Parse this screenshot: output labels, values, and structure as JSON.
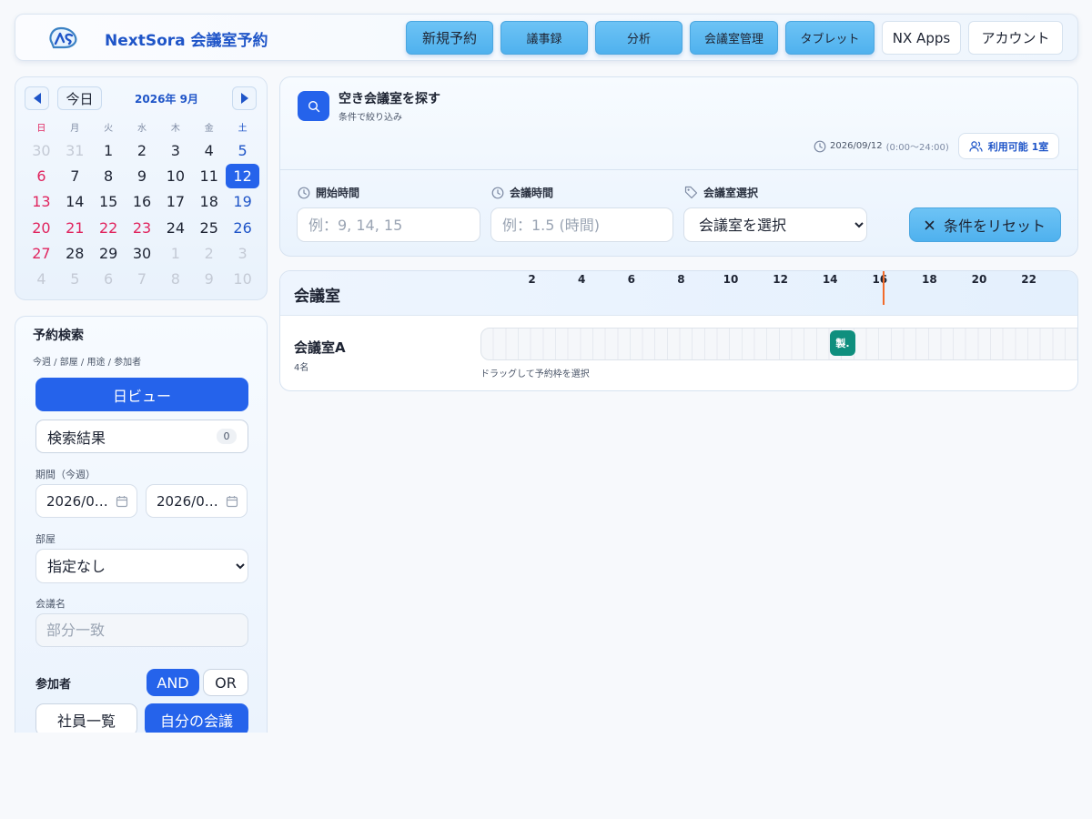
{
  "header": {
    "brand": "NextSora 会議室予約",
    "nav": [
      {
        "label": "新規予約"
      },
      {
        "label": "議事録"
      },
      {
        "label": "分析"
      },
      {
        "label": "会議室管理"
      },
      {
        "label": "タブレット"
      },
      {
        "label": "NX Apps"
      },
      {
        "label": "アカウント"
      }
    ]
  },
  "calendar": {
    "today_label": "今日",
    "month_title": "2026年 9月",
    "weekdays": [
      "日",
      "月",
      "火",
      "水",
      "木",
      "金",
      "土"
    ],
    "days": [
      {
        "d": "30",
        "t": "out"
      },
      {
        "d": "31",
        "t": "out"
      },
      {
        "d": "1",
        "t": ""
      },
      {
        "d": "2",
        "t": ""
      },
      {
        "d": "3",
        "t": ""
      },
      {
        "d": "4",
        "t": ""
      },
      {
        "d": "5",
        "t": "sat"
      },
      {
        "d": "6",
        "t": "sun"
      },
      {
        "d": "7",
        "t": ""
      },
      {
        "d": "8",
        "t": ""
      },
      {
        "d": "9",
        "t": ""
      },
      {
        "d": "10",
        "t": ""
      },
      {
        "d": "11",
        "t": ""
      },
      {
        "d": "12",
        "t": "sel"
      },
      {
        "d": "13",
        "t": "sun"
      },
      {
        "d": "14",
        "t": ""
      },
      {
        "d": "15",
        "t": ""
      },
      {
        "d": "16",
        "t": ""
      },
      {
        "d": "17",
        "t": ""
      },
      {
        "d": "18",
        "t": ""
      },
      {
        "d": "19",
        "t": "sat"
      },
      {
        "d": "20",
        "t": "sun"
      },
      {
        "d": "21",
        "t": "sun"
      },
      {
        "d": "22",
        "t": "sun"
      },
      {
        "d": "23",
        "t": "sun"
      },
      {
        "d": "24",
        "t": ""
      },
      {
        "d": "25",
        "t": ""
      },
      {
        "d": "26",
        "t": "sat"
      },
      {
        "d": "27",
        "t": "sun"
      },
      {
        "d": "28",
        "t": ""
      },
      {
        "d": "29",
        "t": ""
      },
      {
        "d": "30",
        "t": ""
      },
      {
        "d": "1",
        "t": "out"
      },
      {
        "d": "2",
        "t": "out"
      },
      {
        "d": "3",
        "t": "out"
      },
      {
        "d": "4",
        "t": "out"
      },
      {
        "d": "5",
        "t": "out"
      },
      {
        "d": "6",
        "t": "out"
      },
      {
        "d": "7",
        "t": "out"
      },
      {
        "d": "8",
        "t": "out"
      },
      {
        "d": "9",
        "t": "out"
      },
      {
        "d": "10",
        "t": "out"
      }
    ]
  },
  "search": {
    "title": "予約検索",
    "subtitle": "今週 / 部屋 / 用途 / 参加者",
    "dayview_label": "日ビュー",
    "results_label": "検索結果",
    "results_count": "0",
    "period_label": "期間（今週）",
    "date_from": "2026/0…",
    "date_to": "2026/0…",
    "room_label": "部屋",
    "room_value": "指定なし",
    "meeting_label": "会議名",
    "meeting_placeholder": "部分一致",
    "participants_label": "参加者",
    "and_label": "AND",
    "or_label": "OR",
    "employees_label": "社員一覧",
    "mine_label": "自分の会議"
  },
  "find": {
    "title": "空き会議室を探す",
    "subtitle": "条件で絞り込み",
    "date": "2026/09/12",
    "range": "(0:00〜24:00)",
    "available_label": "利用可能 1室",
    "start_label": "開始時間",
    "start_placeholder": "例：9, 14, 15",
    "duration_label": "会議時間",
    "duration_placeholder": "例：1.5 (時間)",
    "room_label": "会議室選択",
    "room_value": "会議室を選択",
    "reset_label": "条件をリセット"
  },
  "timeline": {
    "title": "会議室",
    "hours": [
      {
        "label": "2",
        "h": 2
      },
      {
        "label": "4",
        "h": 4
      },
      {
        "label": "6",
        "h": 6
      },
      {
        "label": "8",
        "h": 8
      },
      {
        "label": "10",
        "h": 10
      },
      {
        "label": "12",
        "h": 12
      },
      {
        "label": "14",
        "h": 14
      },
      {
        "label": "16",
        "h": 16
      },
      {
        "label": "18",
        "h": 18
      },
      {
        "label": "20",
        "h": 20
      },
      {
        "label": "22",
        "h": 22
      }
    ],
    "now_hour": 16.2,
    "room": {
      "name": "会議室A",
      "capacity": "4名",
      "booking_label": "製."
    },
    "drag_hint": "ドラッグして予約枠を選択"
  },
  "colors": {
    "primary": "#2563eb",
    "accent": "#4fb1ee",
    "brand": "#1f55c8",
    "booking": "#0f8f7e",
    "now": "#f26b2a",
    "sunday": "#e0245e"
  }
}
